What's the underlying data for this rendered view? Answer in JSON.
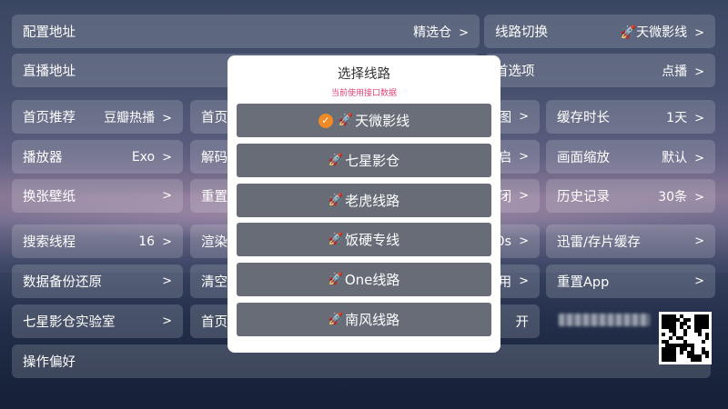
{
  "tiles": [
    {
      "label": "配置地址",
      "value": "精选仓",
      "arrow": ">"
    },
    {
      "label": "线路切换",
      "value": "🚀天微影线",
      "arrow": ">"
    },
    {
      "label": "直播地址",
      "value": "",
      "arrow": ""
    },
    {
      "label": "首选项",
      "value": "点播",
      "arrow": ">"
    },
    {
      "label": "首页推荐",
      "value": "豆瓣热播",
      "arrow": ">"
    },
    {
      "label": "首页",
      "value": "",
      "arrow": ""
    },
    {
      "label": "图",
      "value": "",
      "arrow": ">"
    },
    {
      "label": "缓存时长",
      "value": "1天",
      "arrow": ">"
    },
    {
      "label": "播放器",
      "value": "Exo",
      "arrow": ">"
    },
    {
      "label": "解码",
      "value": "",
      "arrow": ""
    },
    {
      "label": "启",
      "value": "",
      "arrow": ">"
    },
    {
      "label": "画面缩放",
      "value": "默认",
      "arrow": ">"
    },
    {
      "label": "换张壁纸",
      "value": "",
      "arrow": ">"
    },
    {
      "label": "重置",
      "value": "",
      "arrow": ""
    },
    {
      "label": "闭",
      "value": "",
      "arrow": ">"
    },
    {
      "label": "历史记录",
      "value": "30条",
      "arrow": ">"
    },
    {
      "label": "搜索线程",
      "value": "16",
      "arrow": ">"
    },
    {
      "label": "渲染",
      "value": "",
      "arrow": ""
    },
    {
      "label": "0s",
      "value": "",
      "arrow": ">"
    },
    {
      "label": "迅雷/存片缓存",
      "value": "",
      "arrow": ">"
    },
    {
      "label": "数据备份还原",
      "value": "",
      "arrow": ">"
    },
    {
      "label": "清空",
      "value": "",
      "arrow": ""
    },
    {
      "label": "用",
      "value": "",
      "arrow": ">"
    },
    {
      "label": "重置App",
      "value": "",
      "arrow": ">"
    },
    {
      "label": "七星影仓实验室",
      "value": "",
      "arrow": ">"
    },
    {
      "label": "首页",
      "value": "",
      "arrow": ""
    },
    {
      "label": "开",
      "value": "",
      "arrow": ""
    },
    {
      "label": "操作偏好",
      "value": "",
      "arrow": ""
    }
  ],
  "dialog": {
    "title": "选择线路",
    "subtitle": "当前使用接口数据",
    "check_icon": "check-circle-icon",
    "rocket_icon": "rocket-icon",
    "routes": [
      {
        "name": "天微影线",
        "selected": true
      },
      {
        "name": "七星影仓",
        "selected": false
      },
      {
        "name": "老虎线路",
        "selected": false
      },
      {
        "name": "饭硬专线",
        "selected": false
      },
      {
        "name": "One线路",
        "selected": false
      },
      {
        "name": "南风线路",
        "selected": false
      }
    ]
  },
  "colors": {
    "accent": "#f08a24",
    "subtitle": "#e0437a",
    "route_bg": "#676c77"
  }
}
